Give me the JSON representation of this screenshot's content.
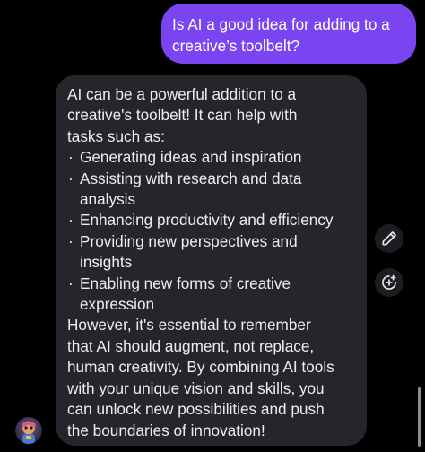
{
  "user_message": {
    "lines": [
      "Is AI a good idea for adding to a",
      "creative’s toolbelt?"
    ]
  },
  "assistant_message": {
    "intro_lines": [
      "AI can be a powerful addition to a",
      "creative's toolbelt! It can help with",
      "tasks such as:"
    ],
    "bullet_marker": "·",
    "bullets": [
      {
        "first": "Generating ideas and inspiration",
        "rest": ""
      },
      {
        "first": "Assisting with research and data",
        "rest": "analysis"
      },
      {
        "first": "Enhancing productivity and efficiency",
        "rest": ""
      },
      {
        "first": "Providing new perspectives and",
        "rest": "insights"
      },
      {
        "first": "Enabling new forms of creative",
        "rest": "expression"
      }
    ],
    "outro_lines": [
      "However, it's essential to remember",
      "that AI should augment, not replace,",
      "human creativity. By combining AI tools",
      "with your unique vision and skills, you",
      "can unlock new possibilities and push",
      "the boundaries of innovation!"
    ]
  },
  "actions": {
    "edit_icon": "pencil-icon",
    "add_icon": "circle-plus-icon"
  },
  "colors": {
    "background": "#000000",
    "user_bubble": "#7a45f0",
    "assistant_bubble": "#24262b",
    "text": "#eceef1"
  }
}
